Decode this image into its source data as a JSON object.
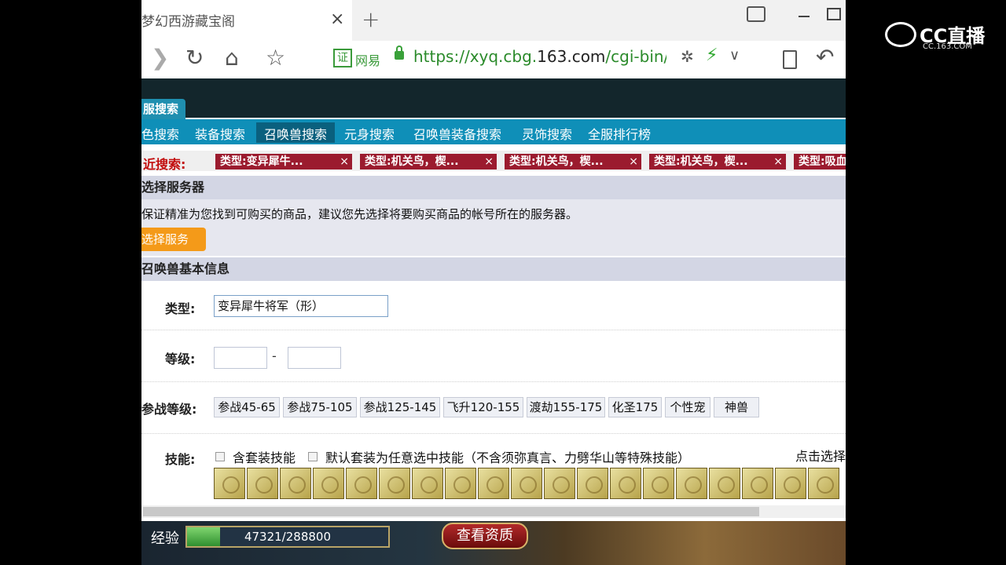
{
  "browser": {
    "tab_title": "梦幻西游藏宝阁",
    "tab_close": "×",
    "new_tab": "+",
    "cert_badge": "证",
    "cert_label": "网易",
    "url_scheme": "https://xyq.cbg.",
    "url_host": "163.com",
    "url_path": "/cgi-bin/ec"
  },
  "nav": {
    "server_tab": "服搜索",
    "items": [
      "色搜索",
      "装备搜索",
      "召唤兽搜索",
      "元身搜索",
      "召唤兽装备搜索",
      "灵饰搜索",
      "全服排行榜"
    ]
  },
  "recent": {
    "label": "近搜索:",
    "chips": [
      "类型:变异犀牛...",
      "类型:机关鸟，楔...",
      "类型:机关鸟，楔...",
      "类型:机关鸟，楔...",
      "类型:吸血"
    ],
    "close_glyph": "×"
  },
  "server": {
    "heading": "选择服务器",
    "note": "保证精准为您找到可购买的商品，建议您先选择将要购买商品的帐号所在的服务器。",
    "button": "选择服务"
  },
  "pet_info": {
    "heading": "召唤兽基本信息",
    "type_label": "类型:",
    "type_value": "变异犀牛将军（形）",
    "level_label": "等级:",
    "level_dash": "-",
    "grade_label": "参战等级:",
    "grades": [
      "参战45-65",
      "参战75-105",
      "参战125-145",
      "飞升120-155",
      "渡劫155-175",
      "化圣175",
      "个性宠",
      "神兽"
    ],
    "skill_label": "技能:",
    "skill_option_1": "含套装技能",
    "skill_option_2": "默认套装为任意选中技能（不含须弥真言、力劈华山等特殊技能）",
    "skill_hint": "点击选择",
    "skill_icon_count": 19
  },
  "game": {
    "exp_label": "经验",
    "exp_text": "47321/288800",
    "exp_fraction": 0.164,
    "view_button": "查看资质"
  },
  "overlay": {
    "logo_text": "CC直播",
    "logo_sub": "CC.163.COM"
  }
}
